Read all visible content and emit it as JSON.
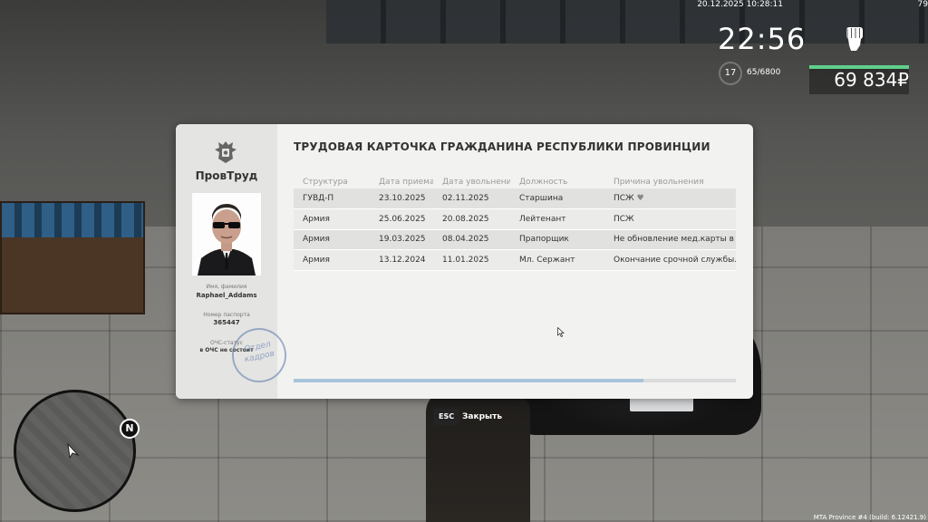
{
  "system": {
    "datetime": "20.12.2025 10:28:11",
    "corner_text": "79",
    "build": "MTA Province #4 (build: 6.12421.9)"
  },
  "hud": {
    "time": "22:56",
    "level": "17",
    "xp": "65/6800",
    "money": "69 834₽",
    "fist_icon": "fist-icon",
    "accent_color": "#5fd08b"
  },
  "card": {
    "ministry": "ПровТруд",
    "title": "ТРУДОВАЯ КАРТОЧКА ГРАЖДАНИНА РЕСПУБЛИКИ ПРОВИНЦИИ",
    "name_label": "Имя, фамилия",
    "name": "Raphael_Addams",
    "passport_label": "Номер паспорта",
    "passport": "365447",
    "ochs_label": "ОЧС-статус",
    "ochs_value": "в ОЧС не состоит",
    "stamp": "Отдел кадров",
    "columns": [
      "Структура",
      "Дата приема",
      "Дата увольнения",
      "Должность",
      "Причина увольнения"
    ],
    "rows": [
      [
        "ГУВД-П",
        "23.10.2025",
        "02.11.2025",
        "Старшина",
        "ПСЖ"
      ],
      [
        "Армия",
        "25.06.2025",
        "20.08.2025",
        "Лейтенант",
        "ПСЖ"
      ],
      [
        "Армия",
        "19.03.2025",
        "08.04.2025",
        "Прапорщик",
        "Не обновление мед.карты в с"
      ],
      [
        "Армия",
        "13.12.2024",
        "11.01.2025",
        "Мл. Сержант",
        "Окончание срочной службы."
      ]
    ],
    "scroll_fraction": 0.79
  },
  "close_hint": {
    "key": "ESC",
    "label": "Закрыть"
  },
  "minimap": {
    "north": "N"
  }
}
